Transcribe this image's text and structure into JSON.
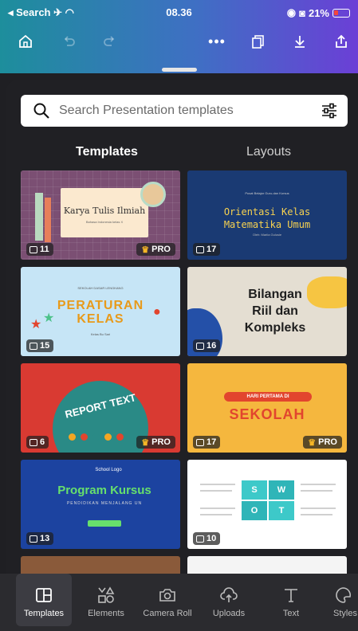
{
  "status_bar": {
    "back_label": "◂ Search",
    "time": "08.36",
    "battery": "21%"
  },
  "search": {
    "placeholder": "Search Presentation templates"
  },
  "tabs": [
    {
      "label": "Templates",
      "active": true
    },
    {
      "label": "Layouts",
      "active": false
    }
  ],
  "templates": [
    {
      "title": "Karya Tulis Ilmiah",
      "subtitle": "Bahasa Indonesia kelas X",
      "pages": "11",
      "pro": "PRO"
    },
    {
      "title_line1": "Orientasi Kelas",
      "title_line2": "Matematika Umum",
      "kicker": "Pusat Belajar Guru-dan Kursus",
      "subtitle": "Oleh: Mariia Gulusie",
      "pages": "17"
    },
    {
      "kicker": "SEKOLAH DASAR LENGKANG",
      "title_line1": "PERATURAN",
      "title_line2": "KELAS",
      "subtitle": "Kelas Bu Sari",
      "pages": "15"
    },
    {
      "title_line1": "Bilangan",
      "title_line2": "Riil dan",
      "title_line3": "Kompleks",
      "pages": "16"
    },
    {
      "title": "REPORT TEXT",
      "pages": "6",
      "pro": "PRO"
    },
    {
      "kicker": "HARI PERTAMA DI",
      "title": "SEKOLAH",
      "pages": "17",
      "pro": "PRO"
    },
    {
      "logo": "School Logo",
      "title": "Program Kursus",
      "subtitle": "PENDIDIKAN MENJALANG UN",
      "pages": "13"
    },
    {
      "s": "S",
      "w": "W",
      "o": "O",
      "t": "T",
      "pages": "10"
    }
  ],
  "bottom_nav": [
    {
      "label": "Templates",
      "icon": "templates-icon",
      "active": true
    },
    {
      "label": "Elements",
      "icon": "elements-icon",
      "active": false
    },
    {
      "label": "Camera Roll",
      "icon": "camera-icon",
      "active": false
    },
    {
      "label": "Uploads",
      "icon": "upload-cloud-icon",
      "active": false
    },
    {
      "label": "Text",
      "icon": "text-icon",
      "active": false
    },
    {
      "label": "Styles",
      "icon": "styles-icon",
      "active": false
    }
  ],
  "colors": {
    "header_start": "#1d8e9c",
    "header_end": "#6b3fd6",
    "sheet_bg": "#202024",
    "pro_crown": "#f6b626"
  }
}
